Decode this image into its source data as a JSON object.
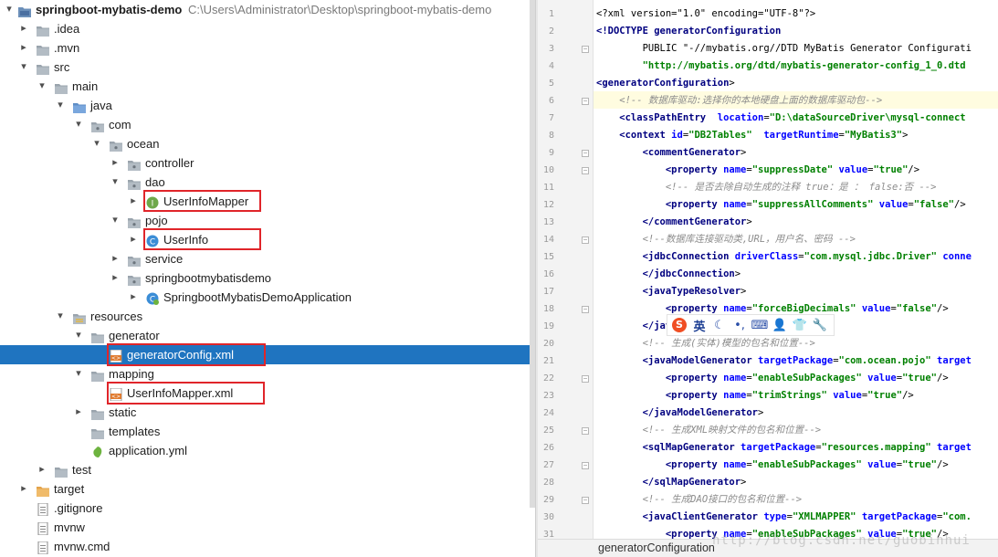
{
  "project": {
    "name": "springboot-mybatis-demo",
    "path": "C:\\Users\\Administrator\\Desktop\\springboot-mybatis-demo"
  },
  "tree": [
    {
      "label": ".idea",
      "icon": "folder-icon",
      "arrow": "▸"
    },
    {
      "label": ".mvn",
      "icon": "folder-icon",
      "arrow": "▸"
    },
    {
      "label": "src",
      "icon": "folder-icon",
      "arrow": "▾"
    },
    {
      "label": "main",
      "icon": "folder-icon",
      "arrow": "▾"
    },
    {
      "label": "java",
      "icon": "source-folder-icon",
      "arrow": "▾"
    },
    {
      "label": "com",
      "icon": "package-icon",
      "arrow": "▾"
    },
    {
      "label": "ocean",
      "icon": "package-icon",
      "arrow": "▾"
    },
    {
      "label": "controller",
      "icon": "package-icon",
      "arrow": "▸"
    },
    {
      "label": "dao",
      "icon": "package-icon",
      "arrow": "▾"
    },
    {
      "label": "UserInfoMapper",
      "icon": "interface-icon",
      "arrow": "▸"
    },
    {
      "label": "pojo",
      "icon": "package-icon",
      "arrow": "▾"
    },
    {
      "label": "UserInfo",
      "icon": "class-icon",
      "arrow": "▸"
    },
    {
      "label": "service",
      "icon": "package-icon",
      "arrow": "▸"
    },
    {
      "label": "springbootmybatisdemo",
      "icon": "package-icon",
      "arrow": "▸"
    },
    {
      "label": "SpringbootMybatisDemoApplication",
      "icon": "spring-class-icon",
      "arrow": "▸"
    },
    {
      "label": "resources",
      "icon": "resources-folder-icon",
      "arrow": "▾"
    },
    {
      "label": "generator",
      "icon": "folder-icon",
      "arrow": "▾"
    },
    {
      "label": "generatorConfig.xml",
      "icon": "xml-file-icon",
      "arrow": ""
    },
    {
      "label": "mapping",
      "icon": "folder-icon",
      "arrow": "▾"
    },
    {
      "label": "UserInfoMapper.xml",
      "icon": "xml-file-icon",
      "arrow": ""
    },
    {
      "label": "static",
      "icon": "folder-icon",
      "arrow": "▸"
    },
    {
      "label": "templates",
      "icon": "folder-icon",
      "arrow": ""
    },
    {
      "label": "application.yml",
      "icon": "yml-file-icon",
      "arrow": ""
    },
    {
      "label": "test",
      "icon": "folder-icon",
      "arrow": "▸"
    },
    {
      "label": "target",
      "icon": "excluded-folder-icon",
      "arrow": "▸"
    },
    {
      "label": ".gitignore",
      "icon": "text-file-icon",
      "arrow": ""
    },
    {
      "label": "mvnw",
      "icon": "text-file-icon",
      "arrow": ""
    },
    {
      "label": "mvnw.cmd",
      "icon": "text-file-icon",
      "arrow": ""
    }
  ],
  "editor": {
    "line_numbers": [
      "1",
      "2",
      "3",
      "4",
      "5",
      "6",
      "7",
      "8",
      "9",
      "10",
      "11",
      "12",
      "13",
      "14",
      "15",
      "16",
      "17",
      "18",
      "19",
      "20",
      "21",
      "22",
      "23",
      "24",
      "25",
      "26",
      "27",
      "28",
      "29",
      "30",
      "31"
    ],
    "lines": [
      [
        [
          "pi",
          "<?xml version=\"1.0\" encoding=\"UTF-8\"?>"
        ]
      ],
      [
        [
          "t",
          "<!DOCTYPE generatorConfiguration"
        ]
      ],
      [
        [
          "pi",
          "        PUBLIC \"-//mybatis.org//DTD MyBatis Generator Configurati"
        ]
      ],
      [
        [
          "v",
          "        \"http://mybatis.org/dtd/mybatis-generator-config_1_0.dtd"
        ]
      ],
      [
        [
          "t",
          "<generatorConfiguration"
        ],
        [
          "pi",
          ">"
        ]
      ],
      [
        [
          "c",
          "    <!-- 数据库驱动:选择你的本地硬盘上面的数据库驱动包-->"
        ]
      ],
      [
        [
          "t",
          "    <classPathEntry"
        ],
        [
          "a",
          "  location"
        ],
        [
          "pi",
          "="
        ],
        [
          "v",
          "\"D:\\dataSourceDriver\\mysql-connect"
        ]
      ],
      [
        [
          "t",
          "    <context"
        ],
        [
          "a",
          " id"
        ],
        [
          "pi",
          "="
        ],
        [
          "v",
          "\"DB2Tables\""
        ],
        [
          "a",
          "  targetRuntime"
        ],
        [
          "pi",
          "="
        ],
        [
          "v",
          "\"MyBatis3\""
        ],
        [
          "pi",
          ">"
        ]
      ],
      [
        [
          "t",
          "        <commentGenerator"
        ],
        [
          "pi",
          ">"
        ]
      ],
      [
        [
          "t",
          "            <property"
        ],
        [
          "a",
          " name"
        ],
        [
          "pi",
          "="
        ],
        [
          "v",
          "\"suppressDate\""
        ],
        [
          "a",
          " value"
        ],
        [
          "pi",
          "="
        ],
        [
          "v",
          "\"true\""
        ],
        [
          "pi",
          "/>"
        ]
      ],
      [
        [
          "c",
          "            <!-- 是否去除自动生成的注释 true：是 ： false:否 -->"
        ]
      ],
      [
        [
          "t",
          "            <property"
        ],
        [
          "a",
          " name"
        ],
        [
          "pi",
          "="
        ],
        [
          "v",
          "\"suppressAllComments\""
        ],
        [
          "a",
          " value"
        ],
        [
          "pi",
          "="
        ],
        [
          "v",
          "\"false\""
        ],
        [
          "pi",
          "/>"
        ]
      ],
      [
        [
          "t",
          "        </commentGenerator"
        ],
        [
          "pi",
          ">"
        ]
      ],
      [
        [
          "c",
          "        <!--数据库连接驱动类,URL，用户名、密码 -->"
        ]
      ],
      [
        [
          "t",
          "        <jdbcConnection"
        ],
        [
          "a",
          " driverClass"
        ],
        [
          "pi",
          "="
        ],
        [
          "v",
          "\"com.mysql.jdbc.Driver\""
        ],
        [
          "a",
          " conne"
        ]
      ],
      [
        [
          "t",
          "        </jdbcConnection"
        ],
        [
          "pi",
          ">"
        ]
      ],
      [
        [
          "t",
          "        <javaTypeResolver"
        ],
        [
          "pi",
          ">"
        ]
      ],
      [
        [
          "t",
          "            <property"
        ],
        [
          "a",
          " name"
        ],
        [
          "pi",
          "="
        ],
        [
          "v",
          "\"forceBigDecimals\""
        ],
        [
          "a",
          " value"
        ],
        [
          "pi",
          "="
        ],
        [
          "v",
          "\"false\""
        ],
        [
          "pi",
          "/>"
        ]
      ],
      [
        [
          "t",
          "        </jav"
        ]
      ],
      [
        [
          "c",
          "        <!-- 生成(实体)模型的包名和位置-->"
        ]
      ],
      [
        [
          "t",
          "        <javaModelGenerator"
        ],
        [
          "a",
          " targetPackage"
        ],
        [
          "pi",
          "="
        ],
        [
          "v",
          "\"com.ocean.pojo\""
        ],
        [
          "a",
          " target"
        ]
      ],
      [
        [
          "t",
          "            <property"
        ],
        [
          "a",
          " name"
        ],
        [
          "pi",
          "="
        ],
        [
          "v",
          "\"enableSubPackages\""
        ],
        [
          "a",
          " value"
        ],
        [
          "pi",
          "="
        ],
        [
          "v",
          "\"true\""
        ],
        [
          "pi",
          "/>"
        ]
      ],
      [
        [
          "t",
          "            <property"
        ],
        [
          "a",
          " name"
        ],
        [
          "pi",
          "="
        ],
        [
          "v",
          "\"trimStrings\""
        ],
        [
          "a",
          " value"
        ],
        [
          "pi",
          "="
        ],
        [
          "v",
          "\"true\""
        ],
        [
          "pi",
          "/>"
        ]
      ],
      [
        [
          "t",
          "        </javaModelGenerator"
        ],
        [
          "pi",
          ">"
        ]
      ],
      [
        [
          "c",
          "        <!-- 生成XML映射文件的包名和位置-->"
        ]
      ],
      [
        [
          "t",
          "        <sqlMapGenerator"
        ],
        [
          "a",
          " targetPackage"
        ],
        [
          "pi",
          "="
        ],
        [
          "v",
          "\"resources.mapping\""
        ],
        [
          "a",
          " target"
        ]
      ],
      [
        [
          "t",
          "            <property"
        ],
        [
          "a",
          " name"
        ],
        [
          "pi",
          "="
        ],
        [
          "v",
          "\"enableSubPackages\""
        ],
        [
          "a",
          " value"
        ],
        [
          "pi",
          "="
        ],
        [
          "v",
          "\"true\""
        ],
        [
          "pi",
          "/>"
        ]
      ],
      [
        [
          "t",
          "        </sqlMapGenerator"
        ],
        [
          "pi",
          ">"
        ]
      ],
      [
        [
          "c",
          "        <!-- 生成DAO接口的包名和位置-->"
        ]
      ],
      [
        [
          "t",
          "        <javaClientGenerator"
        ],
        [
          "a",
          " type"
        ],
        [
          "pi",
          "="
        ],
        [
          "v",
          "\"XMLMAPPER\""
        ],
        [
          "a",
          " targetPackage"
        ],
        [
          "pi",
          "="
        ],
        [
          "v",
          "\"com."
        ]
      ],
      [
        [
          "t",
          "            <property"
        ],
        [
          "a",
          " name"
        ],
        [
          "pi",
          "="
        ],
        [
          "v",
          "\"enableSubPackages\""
        ],
        [
          "a",
          " value"
        ],
        [
          "pi",
          "="
        ],
        [
          "v",
          "\"true\""
        ],
        [
          "pi",
          "/>"
        ]
      ]
    ]
  },
  "ime": {
    "lang": "英"
  },
  "status": {
    "breadcrumb": "generatorConfiguration"
  },
  "watermark": "http://blog.csdn.net/guobinhui",
  "colors": {
    "selection": "#1f74c0",
    "highlight_box": "#e0252a",
    "tag": "#000080",
    "attr": "#0000ff",
    "value": "#008000",
    "comment": "#8c8c8c"
  }
}
